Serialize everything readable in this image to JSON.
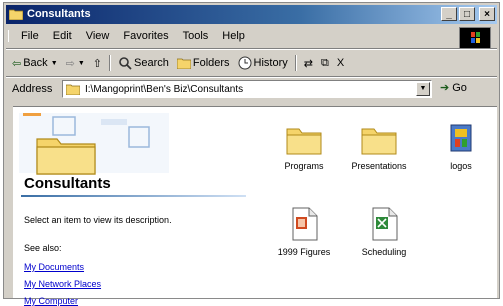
{
  "window": {
    "title": "Consultants"
  },
  "title_buttons": [
    "_",
    "□",
    "×"
  ],
  "menu": [
    "File",
    "Edit",
    "View",
    "Favorites",
    "Tools",
    "Help"
  ],
  "toolbar": {
    "back": "Back",
    "forward_glyph": "⇨",
    "up_glyph": "⇧",
    "search": "Search",
    "folders": "Folders",
    "history": "History",
    "move_glyph": "⇄",
    "copy_glyph": "⧉",
    "delete_glyph": "X"
  },
  "address": {
    "label": "Address",
    "value": "I:\\Mangoprint\\Ben's Biz\\Consultants",
    "go": "Go"
  },
  "info_pane": {
    "folder_title": "Consultants",
    "description": "Select an item to view its description.",
    "see_also": "See also:",
    "links": [
      "My Documents",
      "My Network Places",
      "My Computer"
    ]
  },
  "files": [
    {
      "name": "Programs",
      "icon": "folder-icon"
    },
    {
      "name": "Presentations",
      "icon": "folder-icon"
    },
    {
      "name": "logos",
      "icon": "application-icon"
    },
    {
      "name": "1999 Figures",
      "icon": "powerpoint-document-icon"
    },
    {
      "name": "Scheduling",
      "icon": "excel-document-icon"
    }
  ],
  "colors": {
    "titlebar_start": "#0a246a",
    "titlebar_end": "#a6caf0",
    "chrome": "#d4d0c8",
    "link": "#0000cc",
    "folder": "#f5d46a"
  }
}
